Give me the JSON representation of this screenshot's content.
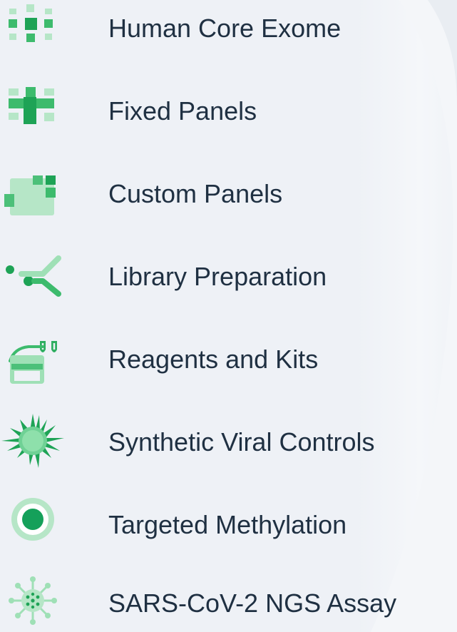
{
  "menu": {
    "items": [
      {
        "label": "Human Core Exome",
        "icon": "grid-squares-icon"
      },
      {
        "label": "Fixed Panels",
        "icon": "plus-squares-icon"
      },
      {
        "label": "Custom Panels",
        "icon": "stacked-blocks-icon"
      },
      {
        "label": "Library Preparation",
        "icon": "forked-strands-icon"
      },
      {
        "label": "Reagents and Kits",
        "icon": "reagent-tray-icon"
      },
      {
        "label": "Synthetic Viral Controls",
        "icon": "spiky-virus-icon"
      },
      {
        "label": "Targeted Methylation",
        "icon": "target-ring-icon"
      },
      {
        "label": "SARS-CoV-2 NGS Assay",
        "icon": "coronavirus-icon"
      }
    ]
  },
  "colors": {
    "accent_dark": "#1ea356",
    "accent_light": "#9fe0b6",
    "text": "#1f3042",
    "background": "#eef1f6"
  }
}
